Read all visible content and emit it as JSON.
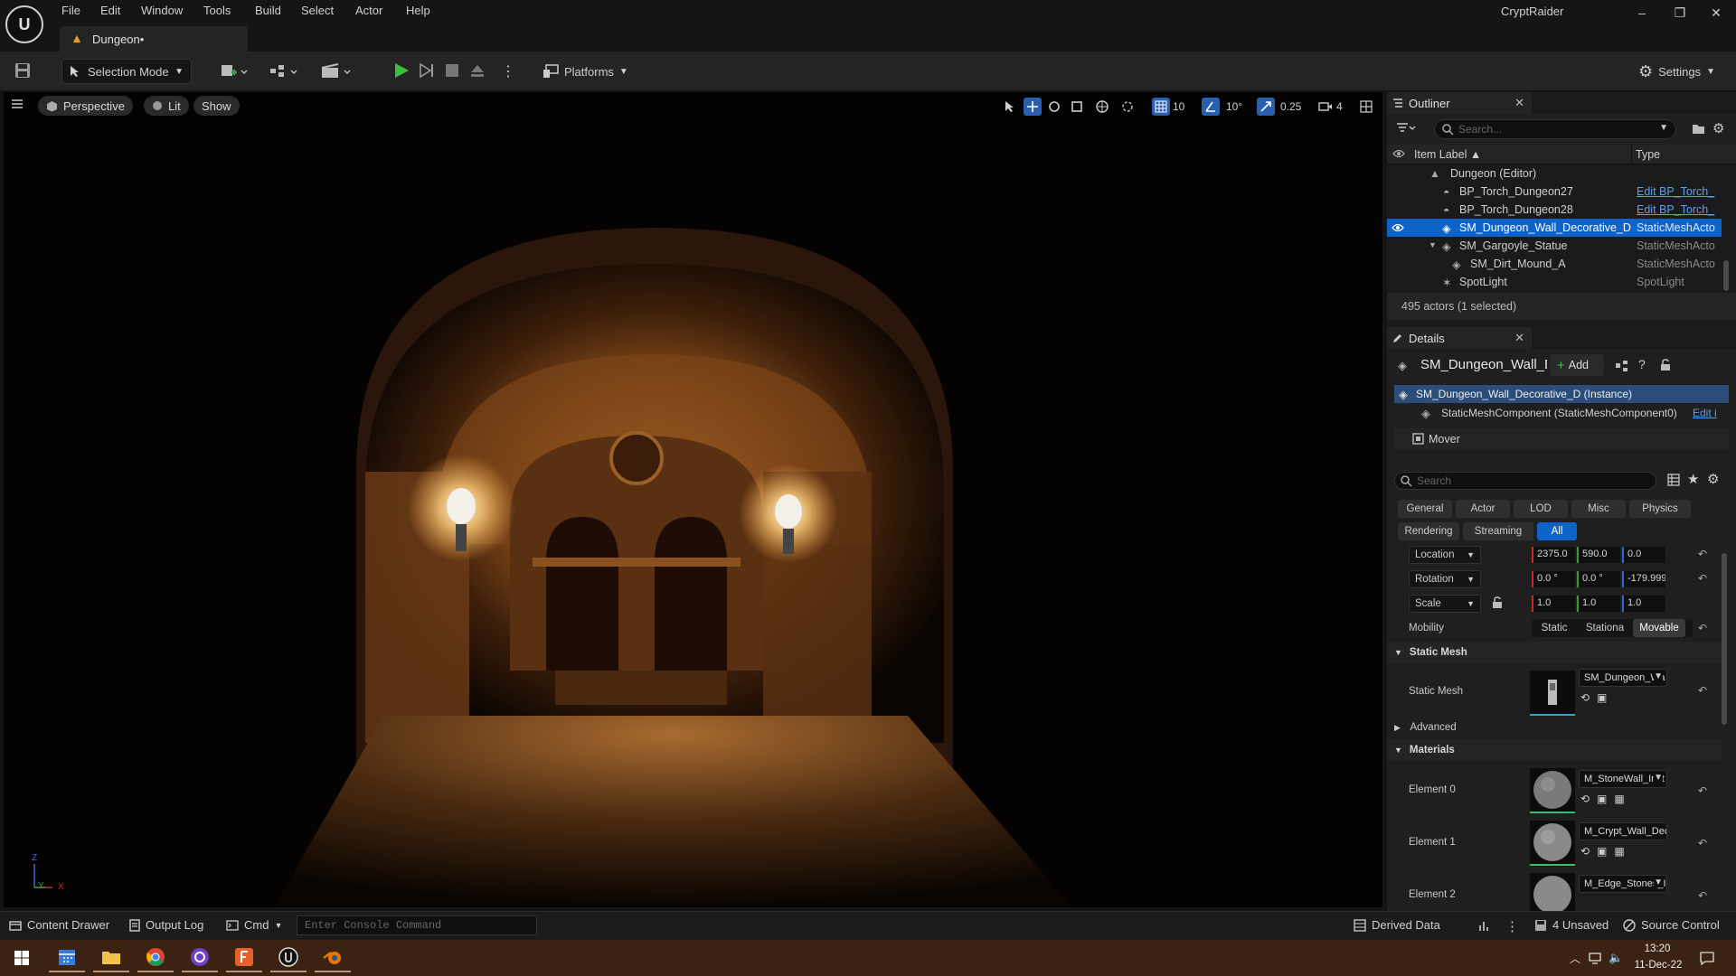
{
  "app": {
    "menu": [
      "File",
      "Edit",
      "Window",
      "Tools",
      "Build",
      "Select",
      "Actor",
      "Help"
    ],
    "doc_tab": "Dungeon•",
    "project_name": "CryptRaider"
  },
  "toolbar": {
    "mode": "Selection Mode",
    "platforms": "Platforms",
    "settings": "Settings"
  },
  "viewport": {
    "perspective": "Perspective",
    "lit": "Lit",
    "show": "Show",
    "grid_snap": "10",
    "rotation_snap": "10°",
    "scale_snap": "0.25",
    "camera_speed": "4",
    "axis_labels": {
      "z": "Z",
      "y": "Y",
      "x": "X"
    }
  },
  "outliner": {
    "tab": "Outliner",
    "search_placeholder": "Search...",
    "col_label": "Item Label ▲",
    "col_type": "Type",
    "rows": [
      {
        "name": "Dungeon (Editor)",
        "type": ""
      },
      {
        "name": "BP_Torch_Dungeon27",
        "type": "Edit BP_Torch_"
      },
      {
        "name": "BP_Torch_Dungeon28",
        "type": "Edit BP_Torch_"
      },
      {
        "name": "SM_Dungeon_Wall_Decorative_D",
        "type": "StaticMeshActo"
      },
      {
        "name": "SM_Gargoyle_Statue",
        "type": "StaticMeshActo"
      },
      {
        "name": "SM_Dirt_Mound_A",
        "type": "StaticMeshActo"
      },
      {
        "name": "SpotLight",
        "type": "SpotLight"
      }
    ],
    "status": "495 actors (1 selected)"
  },
  "details": {
    "tab": "Details",
    "actor_name": "SM_Dungeon_Wall_Deco",
    "add_label": "Add",
    "instance": "SM_Dungeon_Wall_Decorative_D (Instance)",
    "component": "StaticMeshComponent (StaticMeshComponent0)",
    "component_edit": "Edit i",
    "mover": "Mover",
    "search_placeholder": "Search",
    "categories_row1": [
      "General",
      "Actor",
      "LOD",
      "Misc",
      "Physics"
    ],
    "categories_row2": [
      "Rendering",
      "Streaming",
      "All"
    ],
    "active_category": "All",
    "transform": {
      "location_label": "Location",
      "location": [
        "2375.0",
        "590.0",
        "0.0"
      ],
      "rotation_label": "Rotation",
      "rotation": [
        "0.0 °",
        "0.0 °",
        "-179.999"
      ],
      "scale_label": "Scale",
      "scale": [
        "1.0",
        "1.0",
        "1.0"
      ]
    },
    "mobility_label": "Mobility",
    "mobility_options": [
      "Static",
      "Stationa",
      "Movable"
    ],
    "mobility_selected": "Movable",
    "static_mesh_section": "Static Mesh",
    "static_mesh_label": "Static Mesh",
    "static_mesh_value": "SM_Dungeon_Wa",
    "advanced_section": "Advanced",
    "materials_section": "Materials",
    "materials": [
      {
        "label": "Element 0",
        "value": "M_StoneWall_Inst"
      },
      {
        "label": "Element 1",
        "value": "M_Crypt_Wall_Decorati"
      },
      {
        "label": "Element 2",
        "value": "M_Edge_Stones_Inst"
      }
    ]
  },
  "bottombar": {
    "content_drawer": "Content Drawer",
    "output_log": "Output Log",
    "cmd": "Cmd",
    "console_placeholder": "Enter Console Command",
    "derived_data": "Derived Data",
    "unsaved": "4 Unsaved",
    "source_control": "Source Control"
  },
  "taskbar": {
    "time": "13:20",
    "date": "11-Dec-22"
  }
}
